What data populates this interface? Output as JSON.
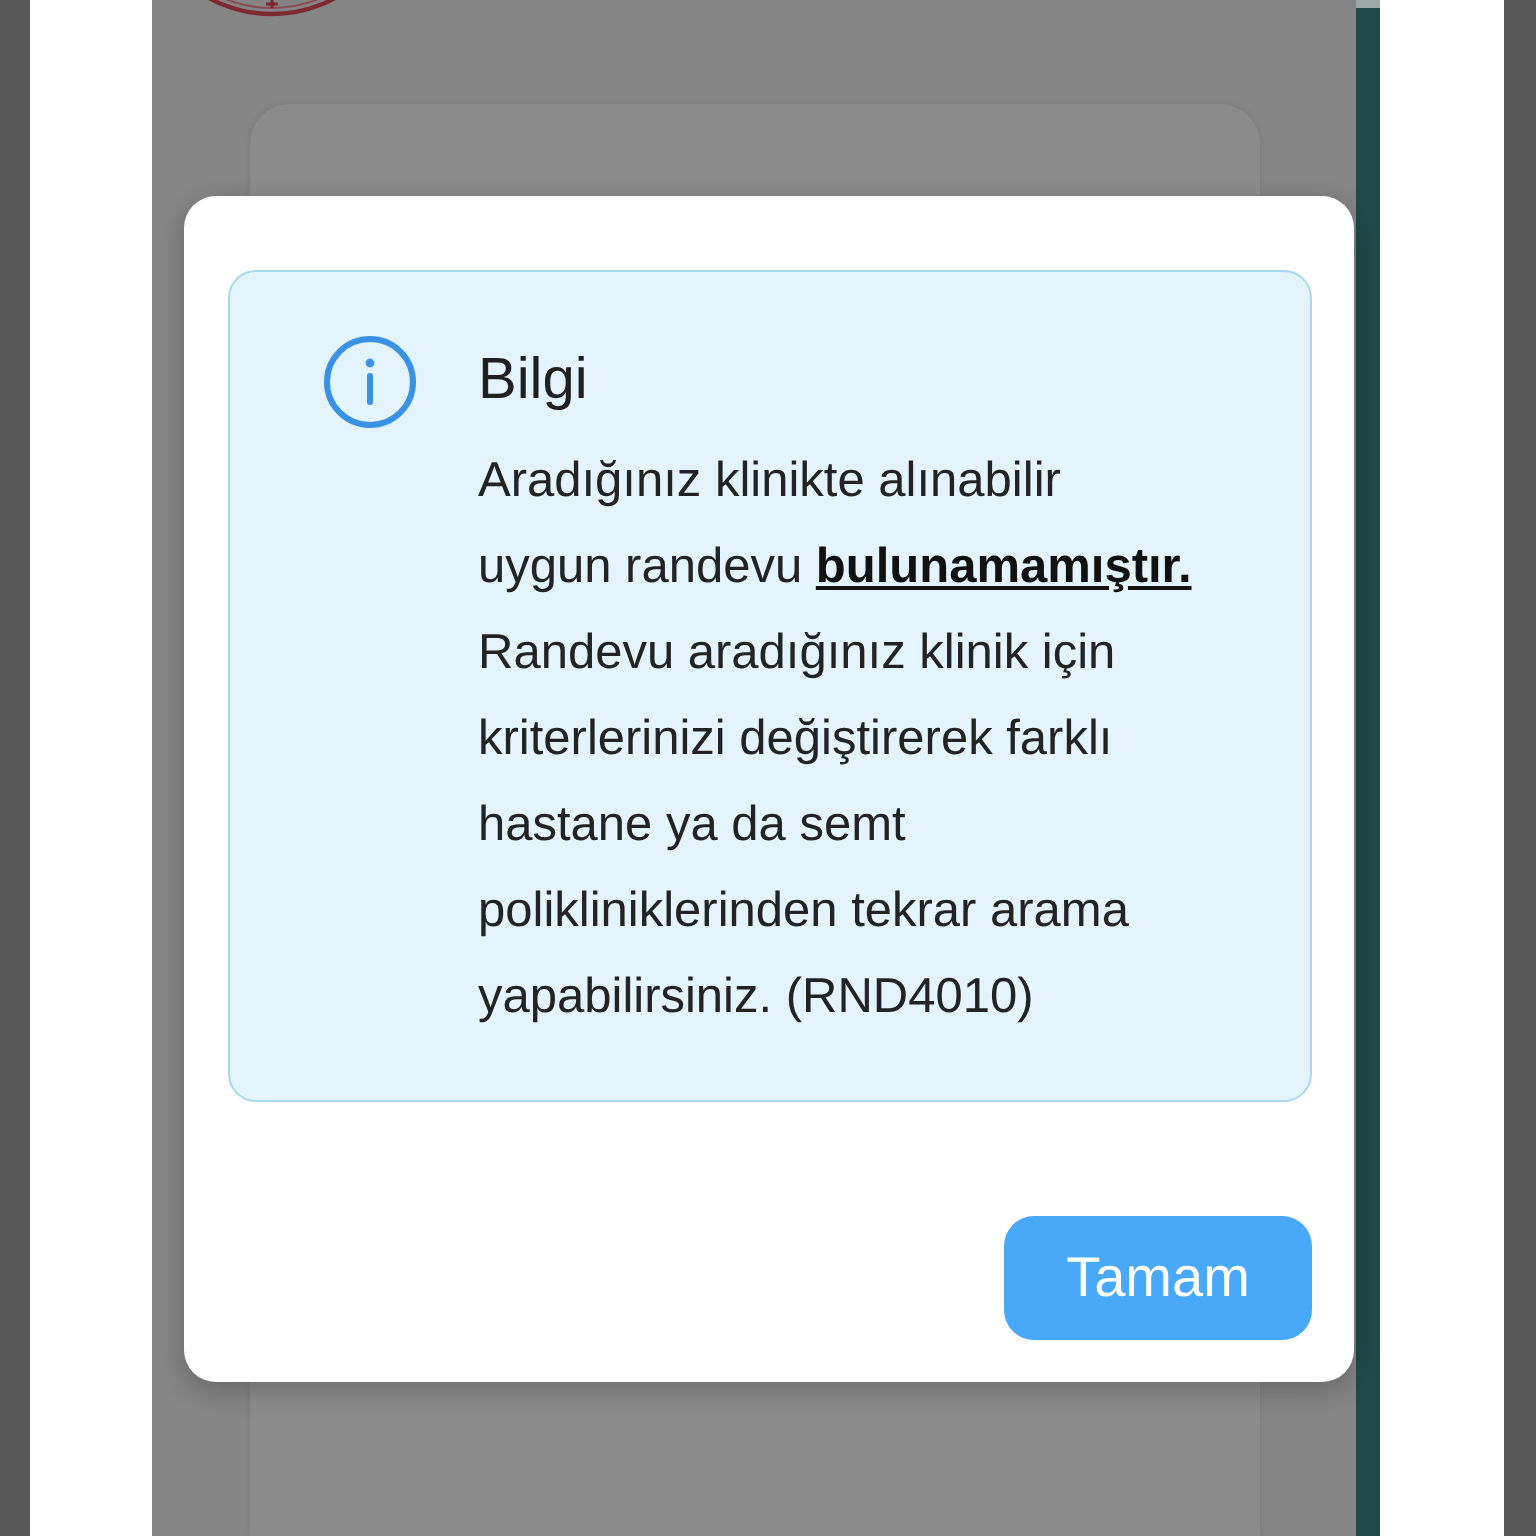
{
  "dialog": {
    "kind": "info",
    "title": "Bilgi",
    "message": "Aradığınız klinikte alınabilir\nuygun randevu **bulunamamıştır.**\nRandevu aradığınız klinik için\nkriterlerinizi değiştirerek farklı\nhastane ya da semt\npolikliniklerinden tekrar arama\nyapabilirsiniz. (RND4010)",
    "buttons": [
      "Tamam"
    ]
  }
}
